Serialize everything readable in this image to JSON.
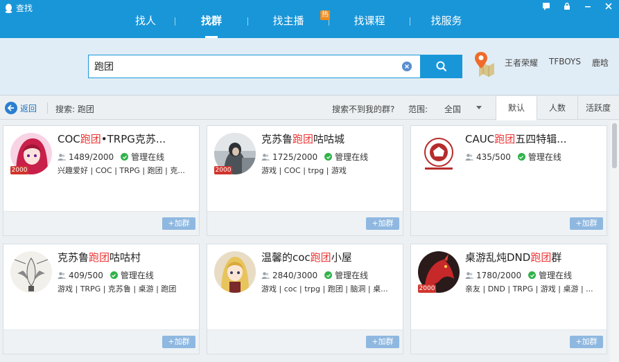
{
  "app": {
    "title": "查找"
  },
  "nav": {
    "items": [
      {
        "label": "找人"
      },
      {
        "label": "找群"
      },
      {
        "label": "找主播",
        "badge": "热"
      },
      {
        "label": "找课程"
      },
      {
        "label": "找服务"
      }
    ]
  },
  "search": {
    "value": "跑团",
    "hot_words": [
      "王者荣耀",
      "TFBOYS",
      "鹿晗"
    ]
  },
  "filter": {
    "back_label": "返回",
    "summary": "搜索: 跑团",
    "not_found": "搜索不到我的群?",
    "range_label": "范围:",
    "range_value": "全国",
    "sort_tabs": [
      "默认",
      "人数",
      "活跃度"
    ]
  },
  "groups": [
    {
      "name_pre": "COC",
      "name_hl": "跑团",
      "name_post": "•TRPG克苏...",
      "members": "1489/2000",
      "admin": "管理在线",
      "tags": "兴趣爱好 | COC | TRPG | 跑团 | 克...",
      "level": "2000",
      "join": "+加群"
    },
    {
      "name_pre": "克苏鲁",
      "name_hl": "跑团",
      "name_post": "咕咕城",
      "members": "1725/2000",
      "admin": "管理在线",
      "tags": "游戏 | COC | trpg | 游戏",
      "level": "2000",
      "join": "+加群"
    },
    {
      "name_pre": "CAUC",
      "name_hl": "跑团",
      "name_post": "五四特辑...",
      "members": "435/500",
      "admin": "管理在线",
      "tags": "",
      "level": "",
      "join": "+加群"
    },
    {
      "name_pre": "克苏鲁",
      "name_hl": "跑团",
      "name_post": "咕咕村",
      "members": "409/500",
      "admin": "管理在线",
      "tags": "游戏 | TRPG | 克苏鲁 | 桌游 | 跑团",
      "level": "",
      "join": "+加群"
    },
    {
      "name_pre": "温馨的coc",
      "name_hl": "跑团",
      "name_post": "小屋",
      "members": "2840/3000",
      "admin": "管理在线",
      "tags": "游戏 | coc | trpg | 跑团 | 脑洞 | 桌...",
      "level": "",
      "join": "+加群"
    },
    {
      "name_pre": "桌游乱炖DND",
      "name_hl": "跑团",
      "name_post": "群",
      "members": "1780/2000",
      "admin": "管理在线",
      "tags": "亲友 | DND | TRPG | 游戏 | 桌游 | ...",
      "level": "2000",
      "join": "+加群"
    }
  ],
  "colors": {
    "primary": "#1996d8",
    "highlight": "#ee3333",
    "online": "#31b24a",
    "level_badge": "#d0342c"
  }
}
